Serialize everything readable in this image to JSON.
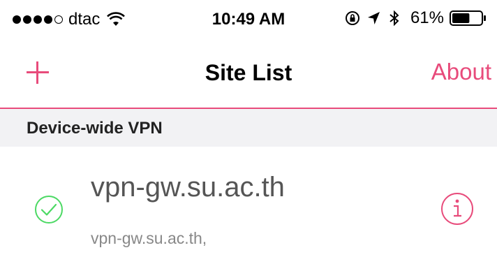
{
  "status_bar": {
    "carrier": "dtac",
    "time": "10:49 AM",
    "battery_percent": "61%",
    "signal_bars": 4,
    "signal_max": 5,
    "battery_level": 0.61
  },
  "nav": {
    "title": "Site List",
    "about_label": "About"
  },
  "section": {
    "title": "Device-wide VPN"
  },
  "sites": [
    {
      "name": "vpn-gw.su.ac.th",
      "subtitle": "vpn-gw.su.ac.th,",
      "status": "connected"
    }
  ],
  "colors": {
    "accent": "#e84b7b",
    "success": "#4cd964",
    "section_bg": "#f2f2f4"
  },
  "icons": {
    "add": "plus-icon",
    "info": "info-icon",
    "status": "checkmark-circle-icon"
  }
}
